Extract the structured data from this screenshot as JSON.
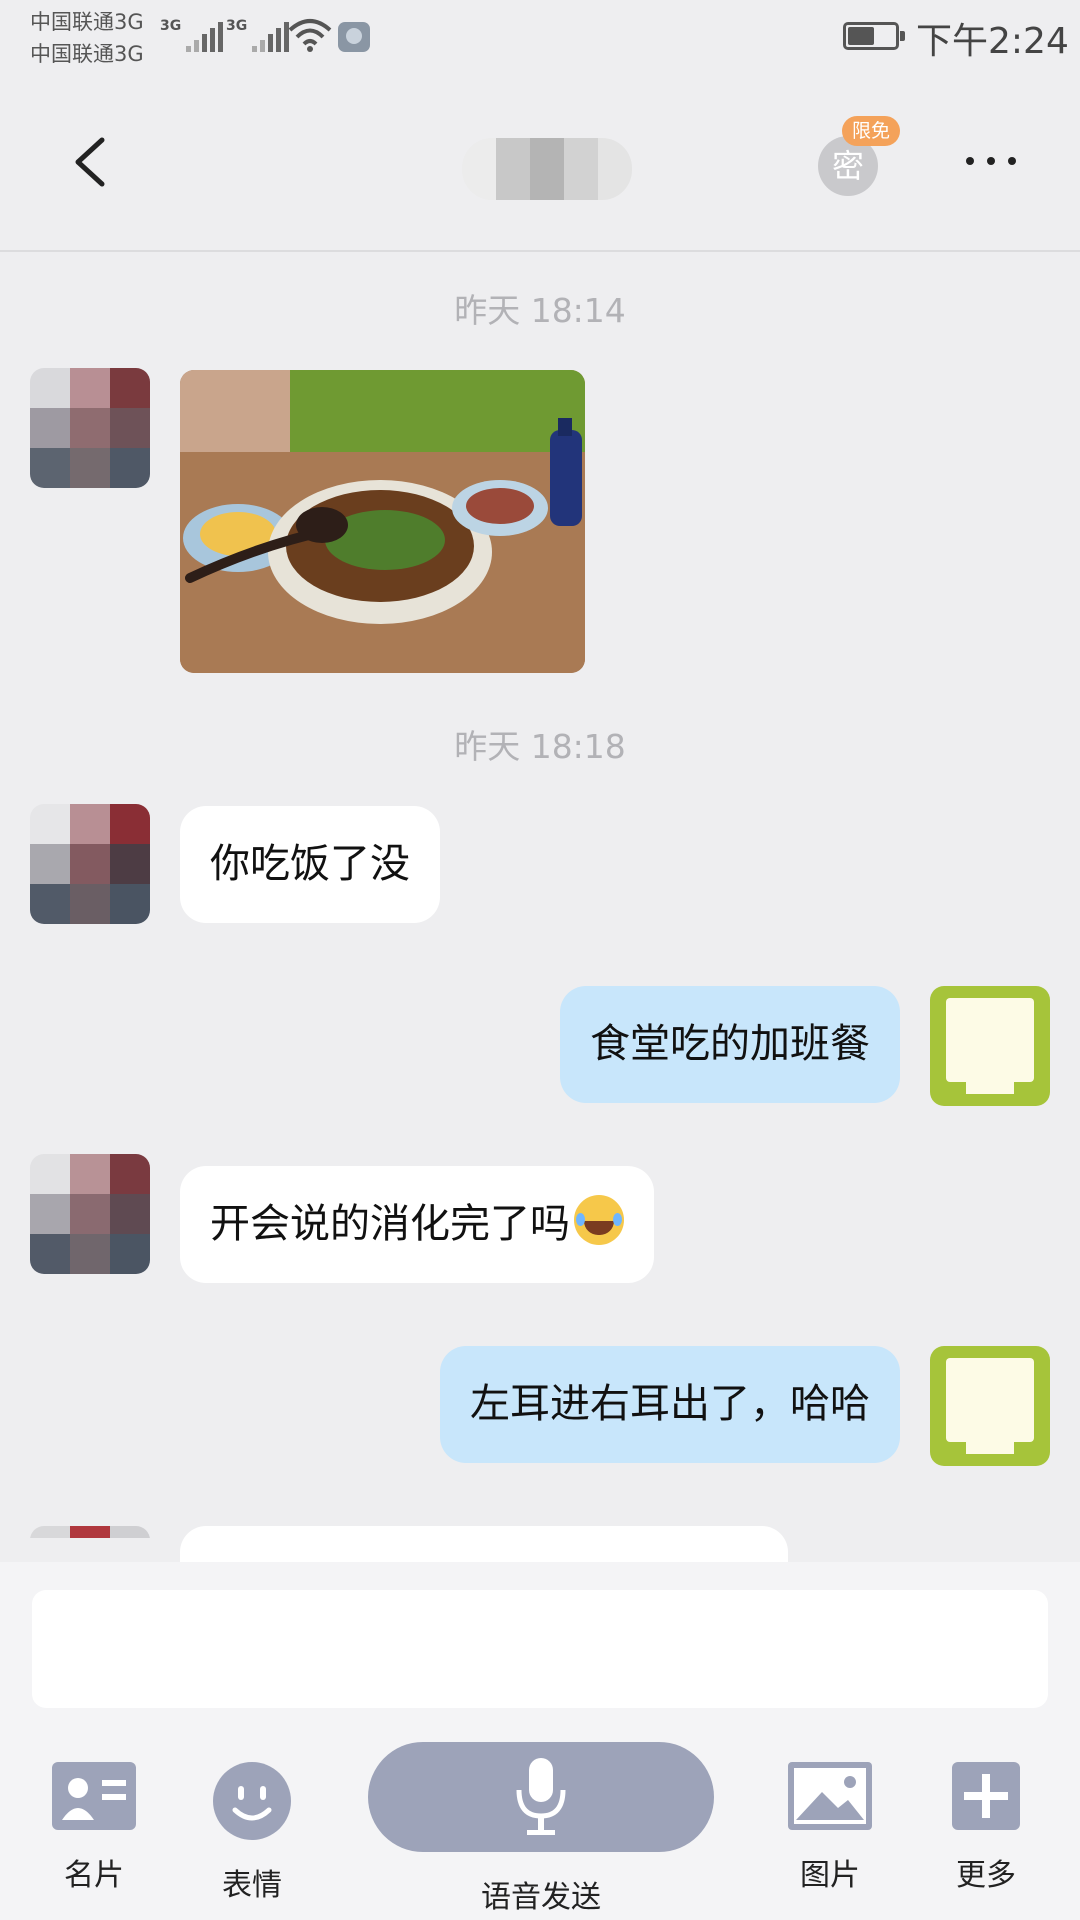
{
  "status_bar": {
    "carrier_1": "中国联通3G",
    "carrier_2": "中国联通3G",
    "network_type_1": "3G",
    "network_type_2": "3G",
    "time": "下午2:24"
  },
  "header": {
    "secret_label": "密",
    "free_badge": "限免"
  },
  "messages": [
    {
      "type": "timestamp",
      "text": "昨天 18:14"
    },
    {
      "type": "image",
      "direction": "in"
    },
    {
      "type": "timestamp",
      "text": "昨天 18:18"
    },
    {
      "type": "text",
      "direction": "in",
      "text": "你吃饭了没"
    },
    {
      "type": "text",
      "direction": "out",
      "text": "食堂吃的加班餐"
    },
    {
      "type": "text",
      "direction": "in",
      "text": "开会说的消化完了吗",
      "emoji": "laughing-tears-emoji"
    },
    {
      "type": "text",
      "direction": "out",
      "text": "左耳进右耳出了，哈哈"
    }
  ],
  "input_area": {
    "input_value": "",
    "tools": {
      "card": "名片",
      "emoji": "表情",
      "voice": "语音发送",
      "image": "图片",
      "more": "更多"
    }
  },
  "colors": {
    "background": "#eeeef0",
    "outgoing_bubble": "#c8e6fb",
    "incoming_bubble": "#ffffff",
    "my_avatar": "#a6c43a",
    "voice_button": "#9da3b9",
    "badge": "#f4a25a"
  }
}
